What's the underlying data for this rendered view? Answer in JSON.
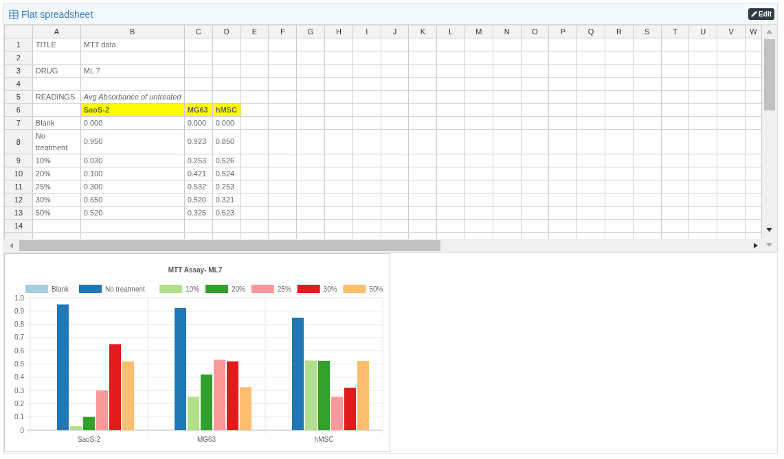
{
  "panel": {
    "title": "Flat spreadsheet",
    "edit_button": "Edit"
  },
  "sheet": {
    "columns": [
      "A",
      "B",
      "C",
      "D",
      "E",
      "F",
      "G",
      "H",
      "I",
      "J",
      "K",
      "L",
      "M",
      "N",
      "O",
      "P",
      "Q",
      "R",
      "S",
      "T",
      "U",
      "V",
      "W"
    ],
    "rows": [
      {
        "number": "1",
        "cells": {
          "A": {
            "kind": "plain",
            "text": "TITLE"
          },
          "B": {
            "kind": "plain",
            "text": "MTT data"
          }
        }
      },
      {
        "number": "2",
        "cells": {}
      },
      {
        "number": "3",
        "cells": {
          "A": {
            "kind": "plain",
            "text": "DRUG"
          },
          "B": {
            "kind": "plain",
            "text": "ML 7"
          }
        }
      },
      {
        "number": "4",
        "cells": {}
      },
      {
        "number": "5",
        "cells": {
          "A": {
            "kind": "plain",
            "text": "READINGS"
          },
          "B": {
            "kind": "note",
            "text": "Avg Absorbance of untreated"
          }
        }
      },
      {
        "number": "6",
        "cells": {
          "B": {
            "kind": "header",
            "text": "SaoS-2"
          },
          "C": {
            "kind": "header",
            "text": "MG63"
          },
          "D": {
            "kind": "header",
            "text": "hMSC"
          }
        }
      },
      {
        "number": "7",
        "cells": {
          "A": {
            "kind": "plain",
            "text": "Blank"
          },
          "B": {
            "kind": "plain",
            "text": "0.000"
          },
          "C": {
            "kind": "plain",
            "text": "0.000"
          },
          "D": {
            "kind": "plain",
            "text": "0.000"
          }
        }
      },
      {
        "number": "8",
        "cells": {
          "A": {
            "kind": "plain",
            "text": "No treatment"
          },
          "B": {
            "kind": "plain",
            "text": "0.950"
          },
          "C": {
            "kind": "plain",
            "text": "0.923"
          },
          "D": {
            "kind": "plain",
            "text": "0.850"
          }
        }
      },
      {
        "number": "9",
        "cells": {
          "A": {
            "kind": "plain",
            "text": "10%"
          },
          "B": {
            "kind": "plain",
            "text": "0.030"
          },
          "C": {
            "kind": "plain",
            "text": "0.253"
          },
          "D": {
            "kind": "plain",
            "text": "0.526"
          }
        }
      },
      {
        "number": "10",
        "cells": {
          "A": {
            "kind": "plain",
            "text": "20%"
          },
          "B": {
            "kind": "plain",
            "text": "0.100"
          },
          "C": {
            "kind": "plain",
            "text": "0.421"
          },
          "D": {
            "kind": "plain",
            "text": "0.524"
          }
        }
      },
      {
        "number": "11",
        "cells": {
          "A": {
            "kind": "plain",
            "text": "25%"
          },
          "B": {
            "kind": "plain",
            "text": "0.300"
          },
          "C": {
            "kind": "plain",
            "text": "0.532"
          },
          "D": {
            "kind": "plain",
            "text": "0.253"
          }
        }
      },
      {
        "number": "12",
        "cells": {
          "A": {
            "kind": "plain",
            "text": "30%"
          },
          "B": {
            "kind": "plain",
            "text": "0.650"
          },
          "C": {
            "kind": "plain",
            "text": "0.520"
          },
          "D": {
            "kind": "plain",
            "text": "0.321"
          }
        }
      },
      {
        "number": "13",
        "cells": {
          "A": {
            "kind": "plain",
            "text": "50%"
          },
          "B": {
            "kind": "plain",
            "text": "0.520"
          },
          "C": {
            "kind": "plain",
            "text": "0.325"
          },
          "D": {
            "kind": "plain",
            "text": "0.523"
          }
        }
      },
      {
        "number": "14",
        "cells": {}
      }
    ]
  },
  "chart": {
    "chart_data": {
      "type": "bar",
      "title": "MTT Assay- ML7",
      "categories": [
        "SaoS-2",
        "MG63",
        "hMSC"
      ],
      "series": [
        {
          "name": "Blank",
          "color": "#a6cee3",
          "values": [
            0,
            0,
            0
          ]
        },
        {
          "name": "No treatment",
          "color": "#1f78b4",
          "values": [
            0.95,
            0.923,
            0.85
          ]
        },
        {
          "name": "10%",
          "color": "#b2df8a",
          "values": [
            0.03,
            0.253,
            0.526
          ]
        },
        {
          "name": "20%",
          "color": "#33a02c",
          "values": [
            0.1,
            0.421,
            0.524
          ]
        },
        {
          "name": "25%",
          "color": "#fb9a99",
          "values": [
            0.3,
            0.532,
            0.253
          ]
        },
        {
          "name": "30%",
          "color": "#e31a1c",
          "values": [
            0.65,
            0.52,
            0.321
          ]
        },
        {
          "name": "50%",
          "color": "#fdbf6f",
          "values": [
            0.52,
            0.325,
            0.523
          ]
        }
      ],
      "ylim": [
        0,
        1
      ],
      "grid": true,
      "legend": true,
      "yticks": [
        0,
        0.1,
        0.2,
        0.3,
        0.4,
        0.5,
        0.6,
        0.7,
        0.8,
        0.9,
        {
          "value": 1,
          "label": "1.0"
        }
      ]
    }
  }
}
